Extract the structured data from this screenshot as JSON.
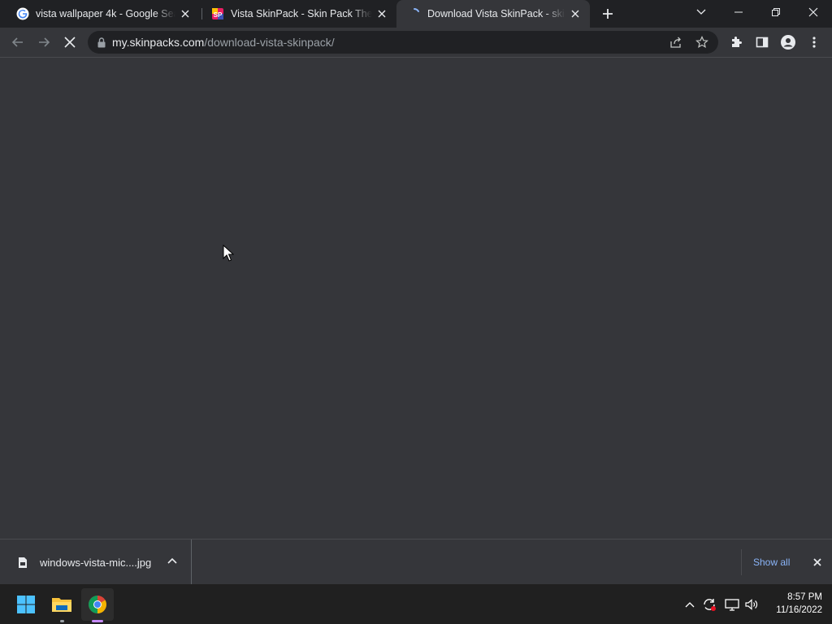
{
  "browser": {
    "tabs": [
      {
        "title": "vista wallpaper 4k - Google Search",
        "active": false
      },
      {
        "title": "Vista SkinPack - Skin Pack Theme",
        "active": false
      },
      {
        "title": "Download Vista SkinPack - skinpacks",
        "active": true
      }
    ],
    "omnibox": {
      "domain": "my.skinpacks.com",
      "path": "/download-vista-skinpack/"
    }
  },
  "downloads": {
    "file_name": "windows-vista-mic....jpg",
    "show_all_label": "Show all"
  },
  "taskbar": {
    "time": "8:57 PM",
    "date": "11/16/2022"
  },
  "colors": {
    "tabstrip": "#202124",
    "toolbar": "#35363a",
    "accent_link": "#8ab4f8",
    "taskbar": "#202020"
  }
}
